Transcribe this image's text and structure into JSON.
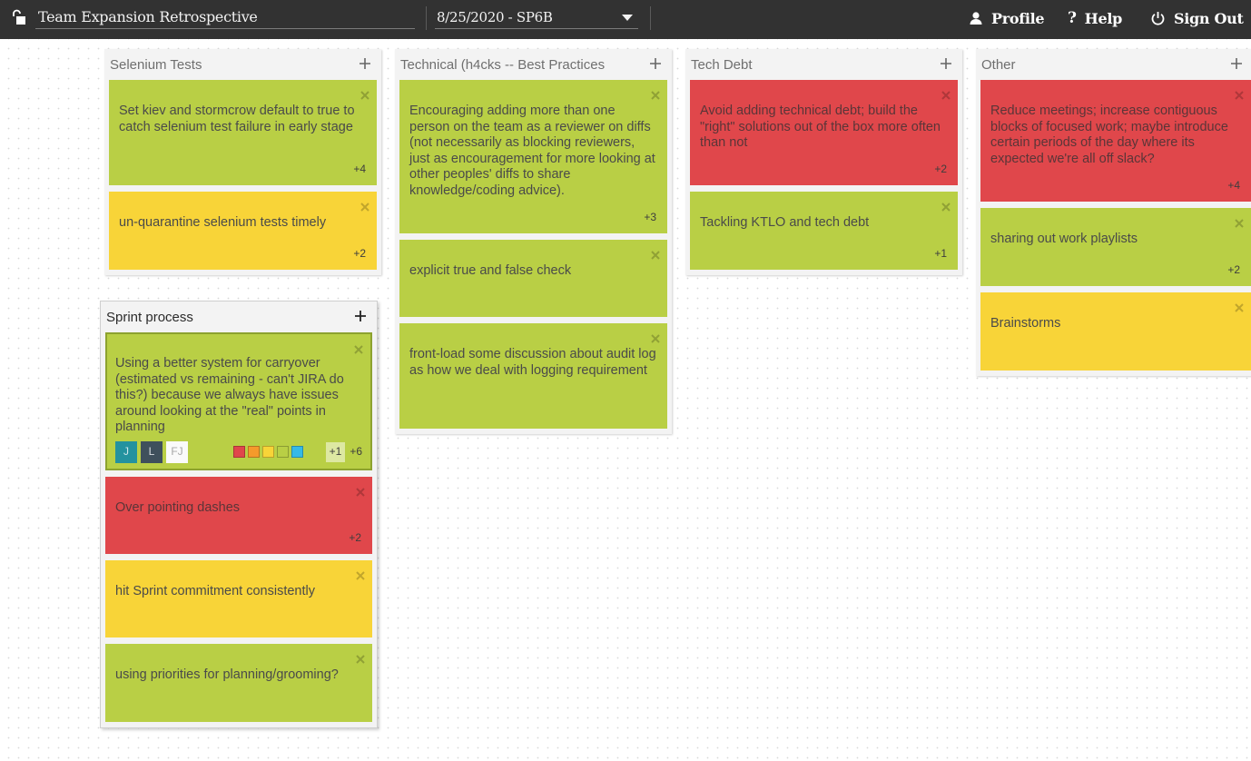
{
  "header": {
    "board_title": "Team Expansion Retrospective",
    "sprint_selected": "8/25/2020 - SP6B",
    "lock_icon": "unlocked-padlock-icon",
    "nav": [
      {
        "label": "Profile",
        "icon": "user-icon"
      },
      {
        "label": "Help",
        "icon": "question-icon"
      },
      {
        "label": "Sign Out",
        "icon": "power-icon"
      }
    ]
  },
  "colors": {
    "green": "#b9cf45",
    "yellow": "#f8d438",
    "red": "#e0474b",
    "orange": "#f59a2b",
    "blue": "#35b9e6",
    "topbar": "#323232"
  },
  "columns": [
    {
      "title": "Selenium Tests",
      "cards": [
        {
          "text": "Set kiev and stormcrow default to true to catch selenium test failure in early stage",
          "color": "green",
          "votes": "+4"
        },
        {
          "text": "un-quarantine selenium tests timely",
          "color": "yellow",
          "votes": "+2"
        }
      ]
    },
    {
      "title": "Sprint process",
      "cards": [
        {
          "text": "Using a better system for carryover (estimated vs remaining - can't JIRA do this?) because we always have issues around looking at the \"real\" points in planning",
          "color": "green",
          "selected": true,
          "avatars": [
            "J",
            "L",
            "FJ"
          ],
          "color_options": [
            "red",
            "orange",
            "yellow",
            "green",
            "blue"
          ],
          "vote_button": "+1",
          "votes": "+6"
        },
        {
          "text": "Over pointing dashes",
          "color": "red",
          "votes": "+2"
        },
        {
          "text": "hit Sprint commitment consistently",
          "color": "yellow",
          "votes": ""
        },
        {
          "text": "using priorities for planning/grooming?",
          "color": "green",
          "votes": ""
        }
      ]
    },
    {
      "title": "Technical (h4cks -- Best Practices",
      "cards": [
        {
          "text": "Encouraging adding more than one person on the team as a reviewer on diffs (not necessarily as blocking reviewers, just as encouragement for more looking at other peoples' diffs to share knowledge/coding advice).",
          "color": "green",
          "votes": "+3"
        },
        {
          "text": "explicit true and false check",
          "color": "green",
          "votes": ""
        },
        {
          "text": "front-load some discussion about audit log as how we deal with logging requirement",
          "color": "green",
          "votes": ""
        }
      ]
    },
    {
      "title": "Tech Debt",
      "cards": [
        {
          "text": "Avoid adding technical debt; build the \"right\" solutions out of the box more often than not",
          "color": "red",
          "votes": "+2"
        },
        {
          "text": "Tackling KTLO and tech debt",
          "color": "green",
          "votes": "+1"
        }
      ]
    },
    {
      "title": "Other",
      "cards": [
        {
          "text": "Reduce meetings; increase contiguous blocks of focused work; maybe introduce certain periods of the day where its expected we're all off slack?",
          "color": "red",
          "votes": "+4"
        },
        {
          "text": "sharing out work playlists",
          "color": "green",
          "votes": "+2"
        },
        {
          "text": "Brainstorms",
          "color": "yellow",
          "votes": ""
        }
      ]
    }
  ]
}
